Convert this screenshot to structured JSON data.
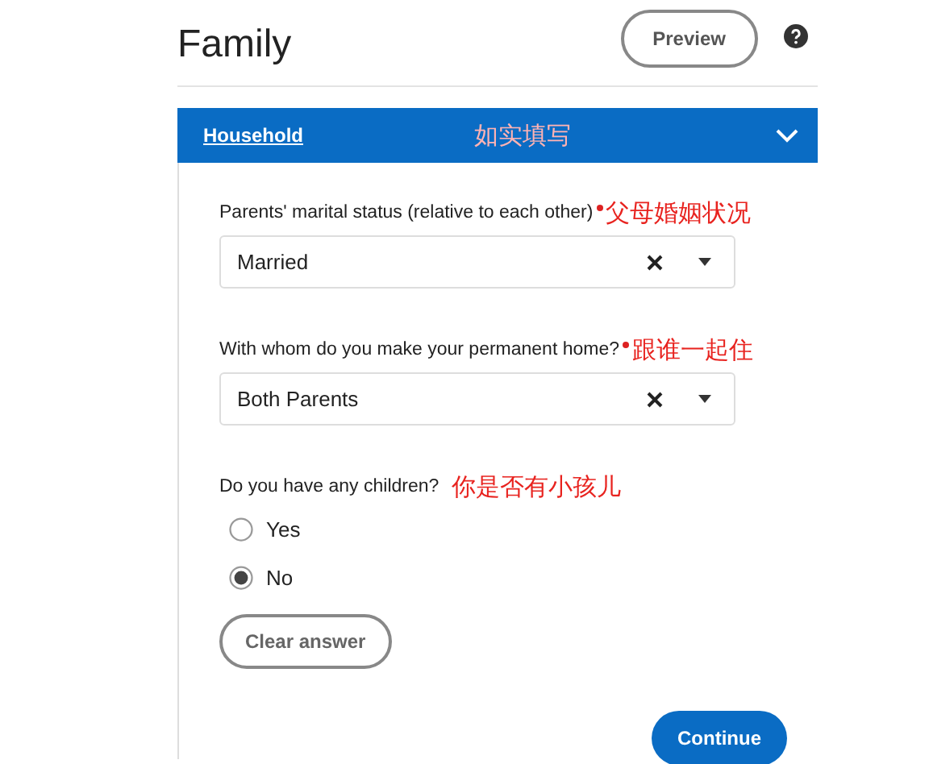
{
  "page": {
    "title": "Family",
    "preview_button": "Preview"
  },
  "section": {
    "title": "Household",
    "expanded": true,
    "note": "如实填写"
  },
  "selects": [
    {
      "label": "Parents' marital status (relative to each other)",
      "required": true,
      "value": "Married",
      "note": "父母婚姻状况"
    },
    {
      "label": "With whom do you make your permanent home?",
      "required": true,
      "value": "Both Parents",
      "note": "跟谁一起住"
    }
  ],
  "question": {
    "label": "Do you have any children?",
    "note": "你是否有小孩儿",
    "options": [
      {
        "label": "Yes",
        "selected": false
      },
      {
        "label": "No",
        "selected": true
      }
    ],
    "clear_button": "Clear answer"
  },
  "continue_button": "Continue"
}
